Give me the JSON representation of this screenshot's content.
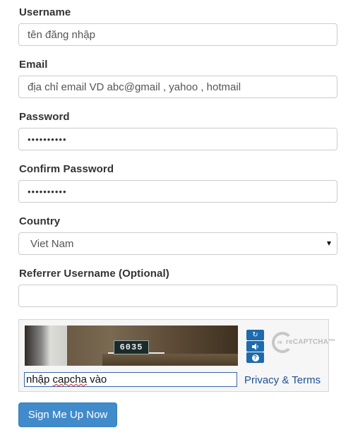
{
  "form": {
    "username": {
      "label": "Username",
      "value": "tên đăng nhập"
    },
    "email": {
      "label": "Email",
      "value": "địa chỉ email VD abc@gmail , yahoo , hotmail"
    },
    "password": {
      "label": "Password",
      "value": "••••••••••"
    },
    "confirm_password": {
      "label": "Confirm Password",
      "value": "••••••••••"
    },
    "country": {
      "label": "Country",
      "selected": "Viet Nam"
    },
    "referrer": {
      "label": "Referrer Username (Optional)",
      "value": ""
    }
  },
  "captcha": {
    "image_text": "6035",
    "input_value_prefix": "nhập ",
    "input_value_underlined": "capcha",
    "input_value_suffix": " vào",
    "privacy_link": "Privacy & Terms",
    "logo_text": "reCAPTCHA™",
    "logo_re": "re",
    "buttons": {
      "refresh": "↻",
      "audio": "🔊",
      "help": "?"
    }
  },
  "submit_label": "Sign Me Up Now",
  "colors": {
    "primary": "#428bca",
    "link": "#1d4f95",
    "captcha_button": "#1d6aad"
  }
}
